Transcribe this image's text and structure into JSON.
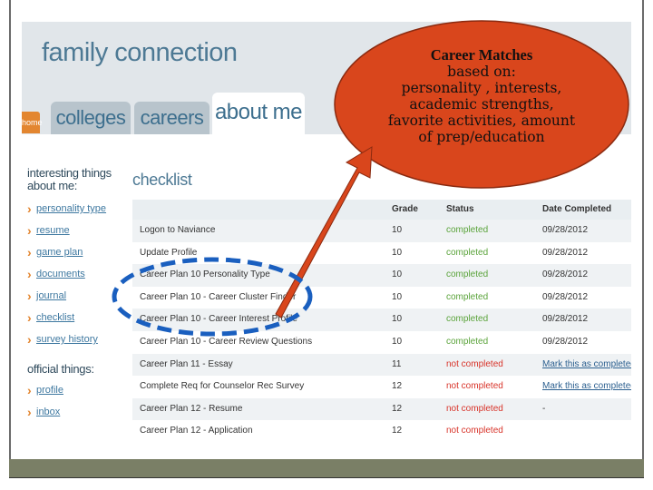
{
  "header": {
    "logo": "family connection",
    "home_tab": "home",
    "tabs": [
      {
        "label": "colleges"
      },
      {
        "label": "careers"
      },
      {
        "label": "about me"
      }
    ]
  },
  "sidebar": {
    "heading1": "interesting things about me:",
    "items": [
      {
        "label": "personality type"
      },
      {
        "label": "resume"
      },
      {
        "label": "game plan"
      },
      {
        "label": "documents"
      },
      {
        "label": "journal"
      },
      {
        "label": "checklist"
      },
      {
        "label": "survey history"
      }
    ],
    "heading2": "official things:",
    "items2": [
      {
        "label": "profile"
      },
      {
        "label": "inbox"
      }
    ]
  },
  "checklist": {
    "title": "checklist",
    "columns": {
      "grade": "Grade",
      "status": "Status",
      "date": "Date Completed"
    },
    "rows": [
      {
        "name": "Logon to Naviance",
        "grade": "10",
        "status": "completed",
        "date": "09/28/2012"
      },
      {
        "name": "Update Profile",
        "grade": "10",
        "status": "completed",
        "date": "09/28/2012"
      },
      {
        "name": "Career Plan 10 Personality Type",
        "grade": "10",
        "status": "completed",
        "date": "09/28/2012"
      },
      {
        "name": "Career Plan 10 - Career Cluster Finder",
        "grade": "10",
        "status": "completed",
        "date": "09/28/2012"
      },
      {
        "name": "Career Plan 10 - Career Interest Profile",
        "grade": "10",
        "status": "completed",
        "date": "09/28/2012"
      },
      {
        "name": "Career Plan 10 - Career Review Questions",
        "grade": "10",
        "status": "completed",
        "date": "09/28/2012"
      },
      {
        "name": "Career Plan 11 - Essay",
        "grade": "11",
        "status": "not completed",
        "date": "Mark this as completed"
      },
      {
        "name": "Complete Req for Counselor Rec Survey",
        "grade": "12",
        "status": "not completed",
        "date": "Mark this as completed"
      },
      {
        "name": "Career Plan 12 - Resume",
        "grade": "12",
        "status": "not completed",
        "date": "-"
      },
      {
        "name": "Career Plan 12 - Application",
        "grade": "12",
        "status": "not completed",
        "date": ""
      }
    ]
  },
  "callout": {
    "title": "Career Matches",
    "lines": [
      "based on:",
      "personality ,  interests,",
      "academic strengths,",
      "favorite activities, amount",
      "of prep/education"
    ],
    "fill_color": "#d9461c",
    "stroke_color": "#8a2a10",
    "arrow_color": "#d9461c"
  },
  "highlight": {
    "color": "#1a5fbf"
  }
}
